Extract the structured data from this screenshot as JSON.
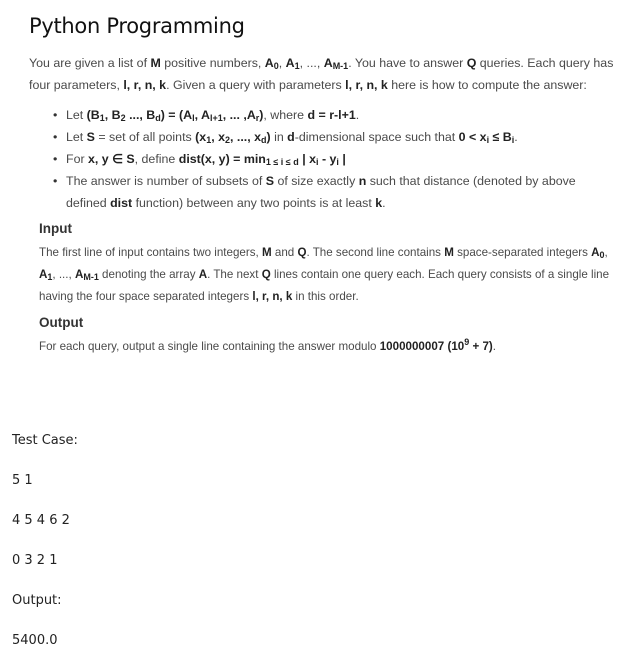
{
  "title": "Python Programming",
  "intro": {
    "t1": "You are given a list of ",
    "M": "M",
    "t2": " positive numbers, ",
    "A": "A",
    "s0": "0",
    "sep1": ", ",
    "s1": "1",
    "dots": ", ..., ",
    "sM1": "M-1",
    "t3": ". You have to answer ",
    "Q": "Q",
    "t4": " queries. Each query has four parameters, ",
    "params": "l, r, n, k",
    "t5": ". Given a query with parameters ",
    "t6": " here is how to compute the answer:"
  },
  "bullets": {
    "b1": {
      "let": "Let ",
      "lhs_open": "(B",
      "s1": "1",
      "mid1": ", B",
      "s2": "2",
      "mid2": " ..., B",
      "sd": "d",
      "eq": ") = (A",
      "sl": "l",
      "mid3": ", A",
      "sl1": "l+1",
      "mid4": ", ... ,A",
      "sr": "r",
      "close": ")",
      "where": ", where ",
      "deq": "d = r-l+1",
      "end": "."
    },
    "b2": {
      "let": "Let ",
      "S": "S",
      "t1": " = set of all points ",
      "x_open": "(x",
      "s1": "1",
      "m1": ", x",
      "s2": "2",
      "m2": ", ..., x",
      "sd": "d",
      "close": ")",
      "t2": " in ",
      "d": "d",
      "t3": "-dimensional space such that ",
      "cond1": "0 < x",
      "si": "i",
      "cond2": "≤ B",
      "si2": "i",
      "end": "."
    },
    "b3": {
      "for": "For ",
      "xy": "x, y ∈ S",
      "t1": ", define ",
      "dist": "dist(x, y) = min",
      "range": "1 ≤ i ≤ d",
      "abs1": " | x",
      "si": "i",
      "minus": " - y",
      "si2": "i",
      "abs2": " |"
    },
    "b4": {
      "t1": "The answer is number of subsets of ",
      "S": "S",
      "t2": " of size exactly ",
      "n": "n",
      "t3": " such that distance (denoted by above defined ",
      "dist": "dist",
      "t4": " function) between any two points is at least ",
      "k": "k",
      "end": "."
    }
  },
  "input_section": {
    "heading": "Input",
    "t1": "The first line of input contains two integers, ",
    "M": "M",
    "and": " and ",
    "Q": "Q",
    "t2": ". The second line contains ",
    "t3": " space-separated integers ",
    "A": "A",
    "s0": "0",
    "sep": ", ",
    "s1": "1",
    "dots": ", ..., ",
    "sM1": "M-1",
    "t4": " denoting the array ",
    "Aarr": "A",
    "t5": ". The next ",
    "t6": " lines contain one query each. Each query consists of a single line having the four space separated integers ",
    "params": "l, r, n, k",
    "t7": " in this order."
  },
  "output_section": {
    "heading": "Output",
    "t1": "For each query, output a single line containing the answer modulo ",
    "mod": "1000000007",
    "paren_open": "(10",
    "exp": "9",
    "paren_close": " + 7)",
    "end": "."
  },
  "test_case": {
    "label": "Test Case:",
    "lines": [
      "5 1",
      "4 5 4 6 2",
      "0 3 2 1"
    ],
    "output_label": "Output:",
    "output_value": "5400.0"
  }
}
